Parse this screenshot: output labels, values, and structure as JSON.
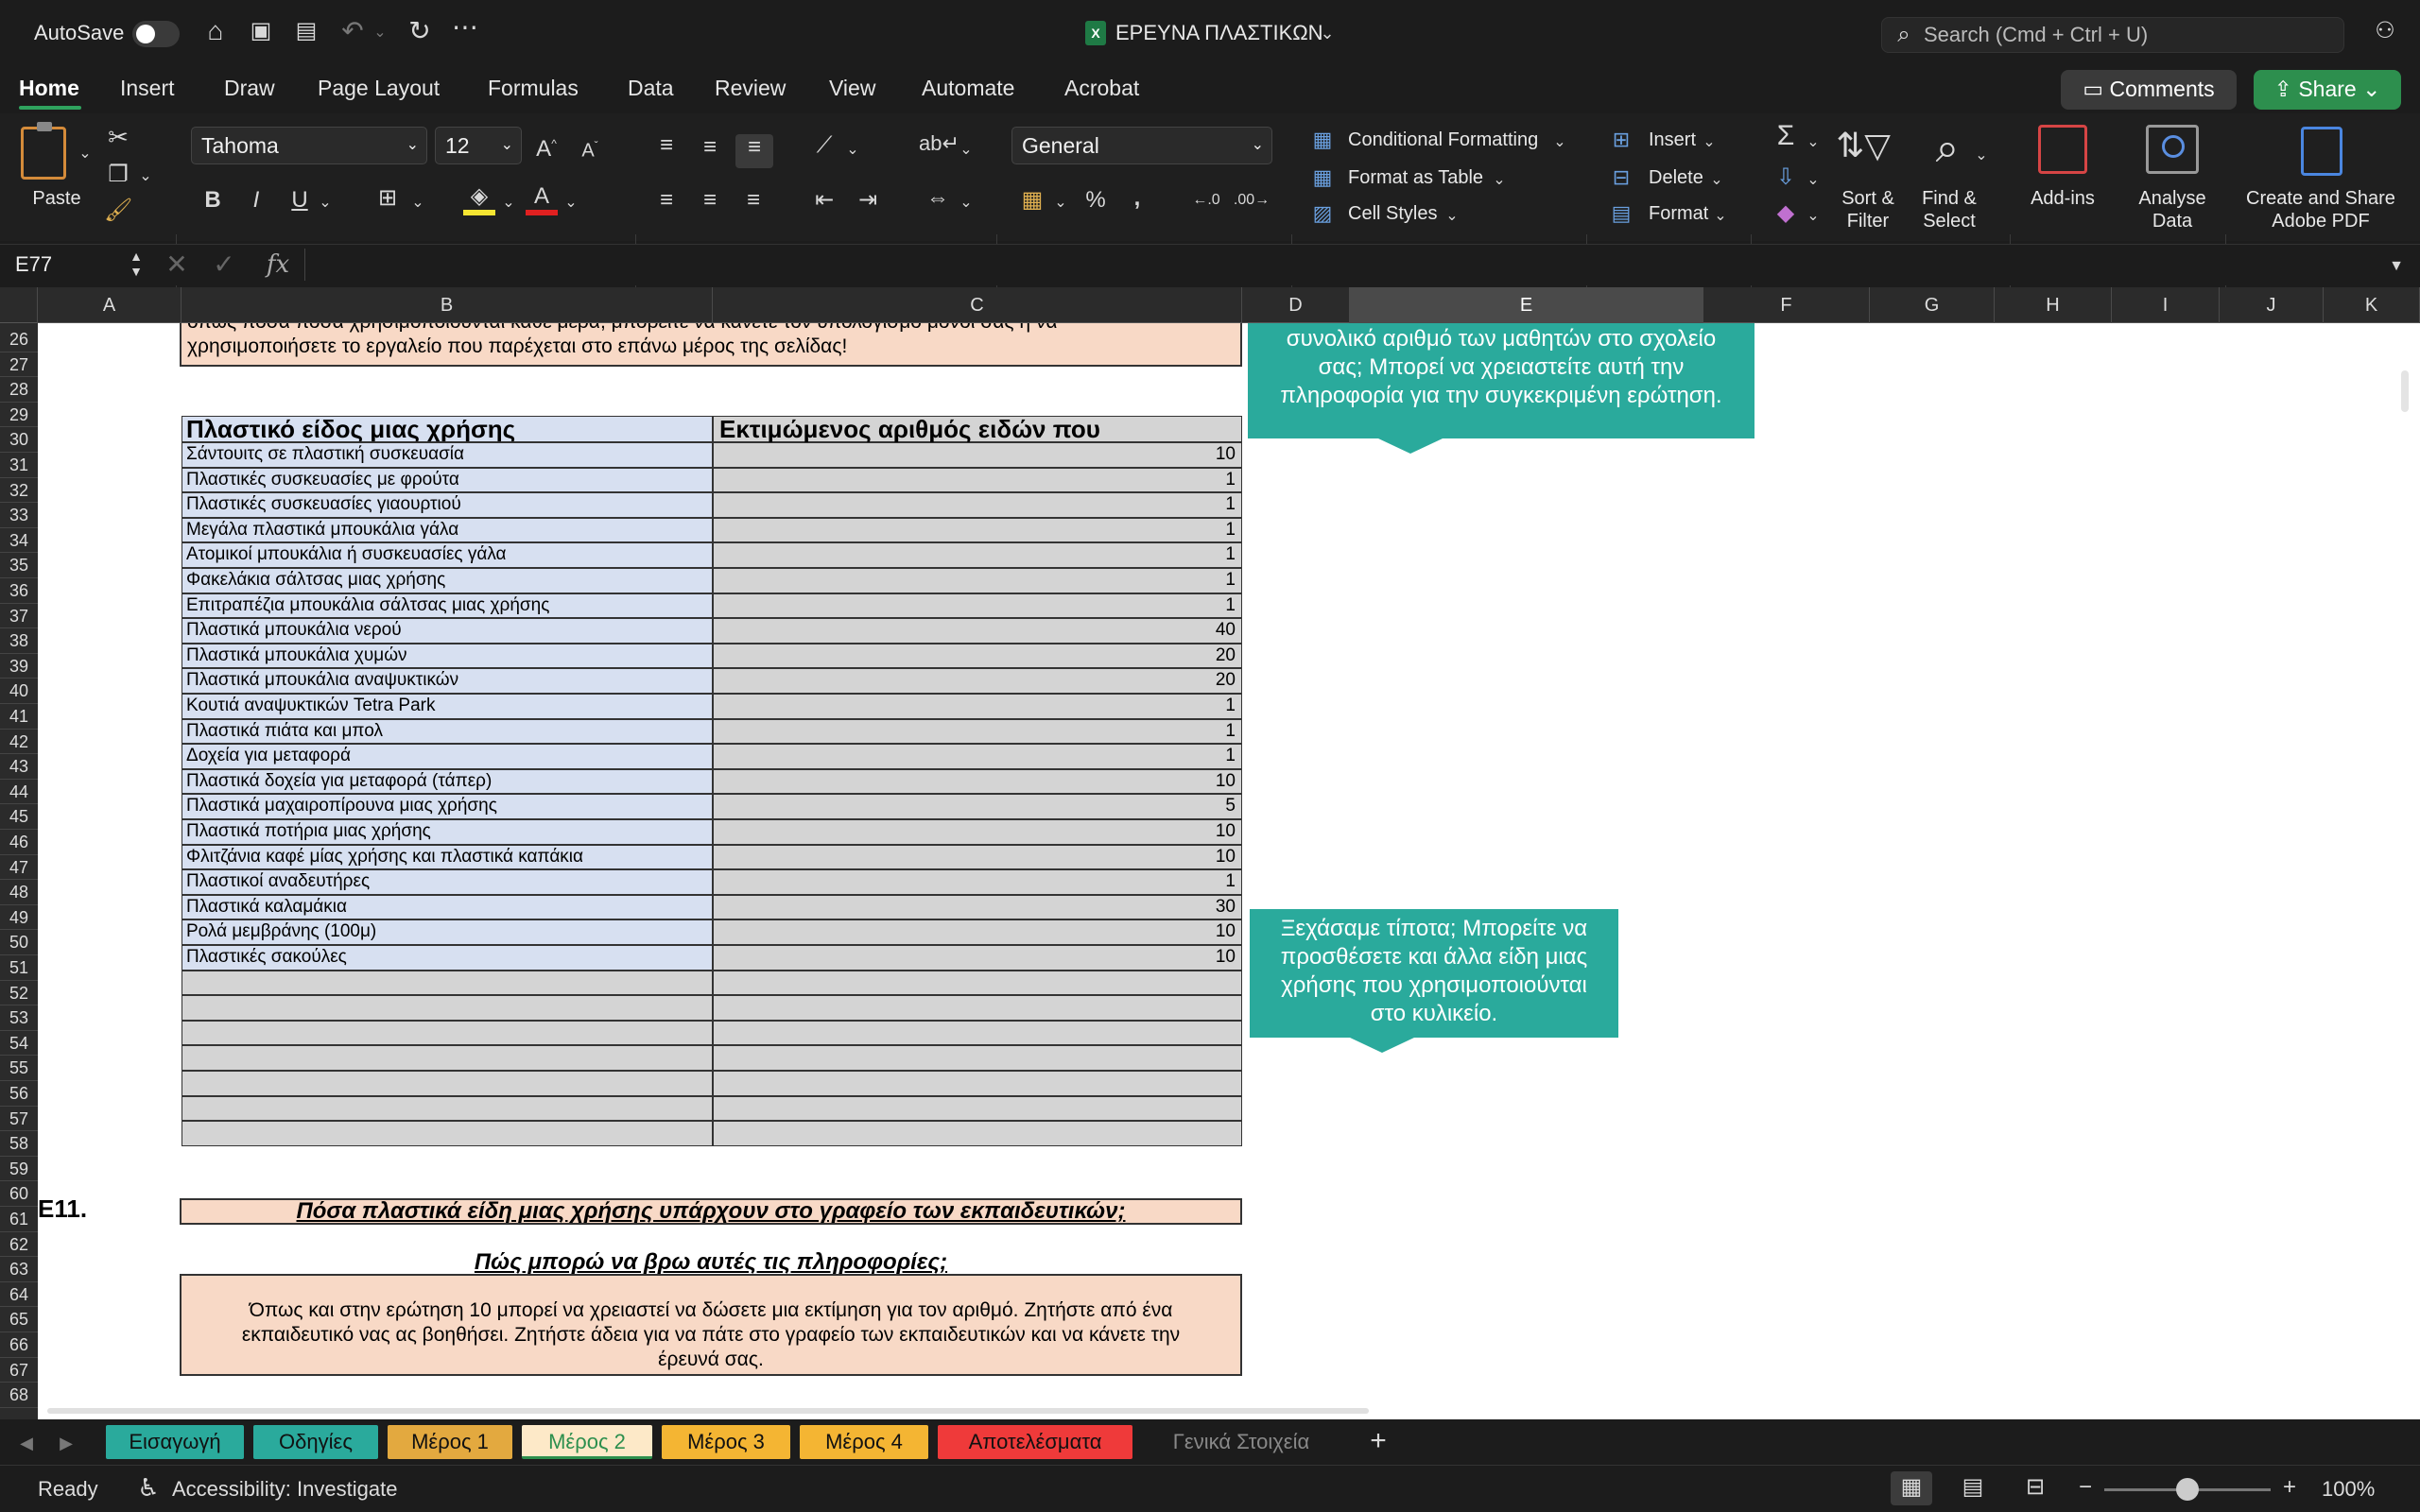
{
  "titlebar": {
    "autosave": "AutoSave",
    "doc_title": "ΕΡΕΥΝΑ ΠΛΑΣΤΙΚΩΝ",
    "search_placeholder": "Search (Cmd + Ctrl + U)"
  },
  "ribbon_tabs": [
    "Home",
    "Insert",
    "Draw",
    "Page Layout",
    "Formulas",
    "Data",
    "Review",
    "View",
    "Automate",
    "Acrobat"
  ],
  "actions": {
    "comments": "Comments",
    "share": "Share"
  },
  "ribbon": {
    "paste": "Paste",
    "font_name": "Tahoma",
    "font_size": "12",
    "number_format": "General",
    "conditional_formatting": "Conditional Formatting",
    "format_as_table": "Format as Table",
    "cell_styles": "Cell Styles",
    "insert": "Insert",
    "delete": "Delete",
    "format": "Format",
    "sort_filter": [
      "Sort &",
      "Filter"
    ],
    "find_select": [
      "Find &",
      "Select"
    ],
    "add_ins": "Add-ins",
    "analyse_data": [
      "Analyse",
      "Data"
    ],
    "create_share": [
      "Create and Share",
      "Adobe PDF"
    ]
  },
  "formula_bar": {
    "name_box": "E77",
    "fx": "fx",
    "value": ""
  },
  "columns": [
    "A",
    "B",
    "C",
    "D",
    "E",
    "F",
    "G",
    "H",
    "I",
    "J",
    "K"
  ],
  "rows": [
    "26",
    "27",
    "28",
    "29",
    "30",
    "31",
    "32",
    "33",
    "34",
    "35",
    "36",
    "37",
    "38",
    "39",
    "40",
    "41",
    "42",
    "43",
    "44",
    "45",
    "46",
    "47",
    "48",
    "49",
    "50",
    "51",
    "52",
    "53",
    "54",
    "55",
    "56",
    "57",
    "58",
    "59",
    "60",
    "61",
    "62",
    "63",
    "64",
    "65",
    "66",
    "67",
    "68"
  ],
  "top_note": [
    "όπως ποσα ποσά χρησιμοποιούνται κάθε μέρα, μπορείτε να κάνετε τον υπολογισμό μόνοι σας ή να",
    "χρησιμοποιήσετε το εργαλείο που παρέχεται στο επάνω μέρος της σελίδας!"
  ],
  "table": {
    "header_b": "Πλαστικό είδος μιας χρήσης",
    "header_c": "Εκτιμώμενος αριθμός ειδών που",
    "rows": [
      {
        "item": "Σάντουιτς σε πλαστική συσκευασία",
        "count": "10"
      },
      {
        "item": "Πλαστικές συσκευασίες με φρούτα",
        "count": "1"
      },
      {
        "item": "Πλαστικές συσκευασίες γιαουρτιού",
        "count": "1"
      },
      {
        "item": "Μεγάλα πλαστικά μπουκάλια γάλα",
        "count": "1"
      },
      {
        "item": "Ατομικοί μπουκάλια ή συσκευασίες γάλα",
        "count": "1"
      },
      {
        "item": "Φακελάκια σάλτσας μιας χρήσης",
        "count": "1"
      },
      {
        "item": "Επιτραπέζια μπουκάλια σάλτσας μιας χρήσης",
        "count": "1"
      },
      {
        "item": "Πλαστικά μπουκάλια νερού",
        "count": "40"
      },
      {
        "item": "Πλαστικά μπουκάλια χυμών",
        "count": "20"
      },
      {
        "item": "Πλαστικά μπουκάλια αναψυκτικών",
        "count": "20"
      },
      {
        "item": "Κουτιά αναψυκτικών Tetra Park",
        "count": "1"
      },
      {
        "item": "Πλαστικά πιάτα και μπολ",
        "count": "1"
      },
      {
        "item": "Δοχεία για μεταφορά",
        "count": "1"
      },
      {
        "item": "Πλαστικά δοχεία για μεταφορά (τάπερ)",
        "count": "10"
      },
      {
        "item": "Πλαστικά μαχαιροπίρουνα μιας χρήσης",
        "count": "5"
      },
      {
        "item": "Πλαστικά ποτήρια μιας χρήσης",
        "count": "10"
      },
      {
        "item": "Φλιτζάνια καφέ μίας χρήσης και πλαστικά καπάκια",
        "count": "10"
      },
      {
        "item": "Πλαστικοί αναδευτήρες",
        "count": "1"
      },
      {
        "item": "Πλαστικά καλαμάκια",
        "count": "30"
      },
      {
        "item": "Ρολά μεμβράνης (100μ)",
        "count": "10"
      },
      {
        "item": "Πλαστικές σακούλες",
        "count": "10"
      }
    ]
  },
  "callout1": [
    "συνολικό αριθμό των μαθητών στο σχολείο",
    "σας; Μπορεί να χρειαστείτε αυτή την",
    "πληροφορία για την συγκεκριμένη ερώτηση."
  ],
  "callout2": [
    "Ξεχάσαμε τίποτα; Μπορείτε να",
    "προσθέσετε και άλλα είδη μιας",
    "χρήσης που χρησιμοποιούνται",
    "στο κυλικείο."
  ],
  "e11": {
    "label": "E11.",
    "question": "Πόσα πλαστικά είδη μιας χρήσης υπάρχουν στο γραφείο των εκπαιδευτικών;",
    "subheading": "Πώς μπορώ να βρω αυτές τις πληροφορίες;",
    "note": [
      "Όπως και στην ερώτηση 10 μπορεί να χρειαστεί να δώσετε μια εκτίμηση για τον αριθμό. Ζητήστε από ένα",
      "εκπαιδευτικό νας ας βοηθήσει. Ζητήστε άδεια για να πάτε στο γραφείο των εκπαιδευτικών και να κάνετε την",
      "έρευνά σας."
    ]
  },
  "sheet_tabs": [
    {
      "label": "Εισαγωγή",
      "bg": "#2aaa9c"
    },
    {
      "label": "Οδηγίες",
      "bg": "#2aaa9c"
    },
    {
      "label": "Μέρος 1",
      "bg": "#e3a93f"
    },
    {
      "label": "Μέρος 2",
      "bg": "#fde9c8"
    },
    {
      "label": "Μέρος 3",
      "bg": "#f4b533"
    },
    {
      "label": "Μέρος 4",
      "bg": "#f4b533"
    },
    {
      "label": "Αποτελέσματα",
      "bg": "#ef3a3a"
    },
    {
      "label": "Γενικά Στοιχεία",
      "bg": "#1c1c1c"
    }
  ],
  "status": {
    "ready": "Ready",
    "accessibility": "Accessibility: Investigate",
    "zoom": "100%"
  }
}
